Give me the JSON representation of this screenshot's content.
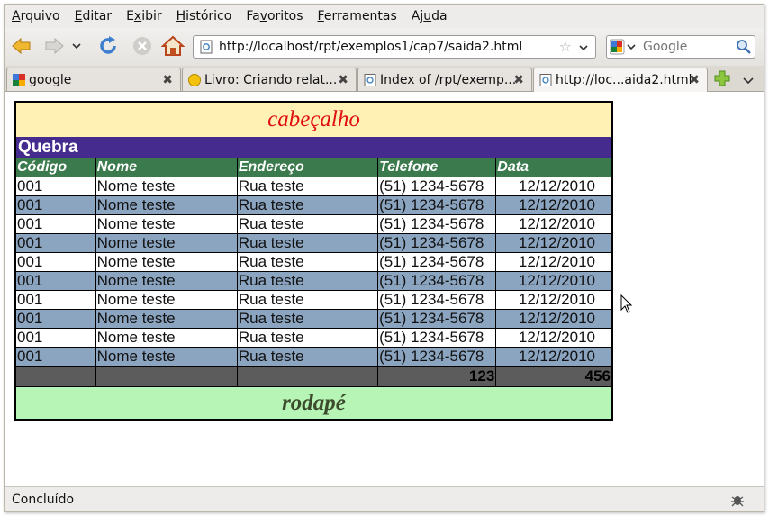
{
  "menubar": {
    "items": [
      "Arquivo",
      "Editar",
      "Exibir",
      "Histórico",
      "Favoritos",
      "Ferramentas",
      "Ajuda"
    ]
  },
  "navbar": {
    "url": "http://localhost/rpt/exemplos1/cap7/saida2.html",
    "search_placeholder": "Google"
  },
  "tabs": [
    {
      "label": "google",
      "active": false
    },
    {
      "label": "Livro: Criando relat...",
      "active": false
    },
    {
      "label": "Index of /rpt/exemp...",
      "active": false
    },
    {
      "label": "http://loc...aida2.html",
      "active": true
    }
  ],
  "report": {
    "header": "cabeçalho",
    "group": "Quebra",
    "columns": [
      "Código",
      "Nome",
      "Endereço",
      "Telefone",
      "Data"
    ],
    "rows": [
      [
        "001",
        "Nome teste",
        "Rua teste",
        "(51) 1234-5678",
        "12/12/2010"
      ],
      [
        "001",
        "Nome teste",
        "Rua teste",
        "(51) 1234-5678",
        "12/12/2010"
      ],
      [
        "001",
        "Nome teste",
        "Rua teste",
        "(51) 1234-5678",
        "12/12/2010"
      ],
      [
        "001",
        "Nome teste",
        "Rua teste",
        "(51) 1234-5678",
        "12/12/2010"
      ],
      [
        "001",
        "Nome teste",
        "Rua teste",
        "(51) 1234-5678",
        "12/12/2010"
      ],
      [
        "001",
        "Nome teste",
        "Rua teste",
        "(51) 1234-5678",
        "12/12/2010"
      ],
      [
        "001",
        "Nome teste",
        "Rua teste",
        "(51) 1234-5678",
        "12/12/2010"
      ],
      [
        "001",
        "Nome teste",
        "Rua teste",
        "(51) 1234-5678",
        "12/12/2010"
      ],
      [
        "001",
        "Nome teste",
        "Rua teste",
        "(51) 1234-5678",
        "12/12/2010"
      ],
      [
        "001",
        "Nome teste",
        "Rua teste",
        "(51) 1234-5678",
        "12/12/2010"
      ]
    ],
    "totals": [
      "",
      "",
      "",
      "123",
      "456"
    ],
    "footer": "rodapé"
  },
  "status": {
    "text": "Concluído"
  },
  "colors": {
    "header_bg": "#fff0b3",
    "header_text": "#e01010",
    "group_bg": "#452b8e",
    "columns_bg": "#3b7a4c",
    "row_alt_bg": "#8ba4c0",
    "totals_bg": "#5c5c5c",
    "footer_bg": "#b7f5b7"
  }
}
